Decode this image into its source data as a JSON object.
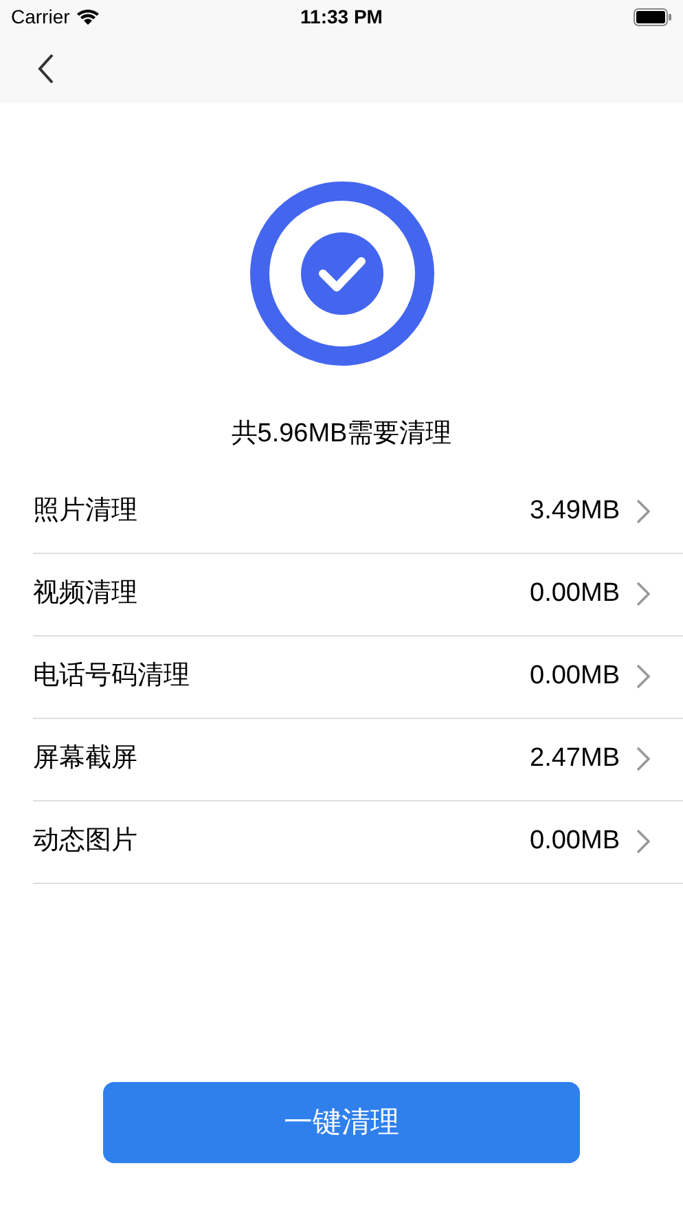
{
  "status_bar": {
    "carrier": "Carrier",
    "time": "11:33 PM"
  },
  "summary": "共5.96MB需要清理",
  "items": [
    {
      "label": "照片清理",
      "size": "3.49MB"
    },
    {
      "label": "视频清理",
      "size": "0.00MB"
    },
    {
      "label": "电话号码清理",
      "size": "0.00MB"
    },
    {
      "label": "屏幕截屏",
      "size": "2.47MB"
    },
    {
      "label": "动态图片",
      "size": "0.00MB"
    }
  ],
  "button": "一键清理"
}
